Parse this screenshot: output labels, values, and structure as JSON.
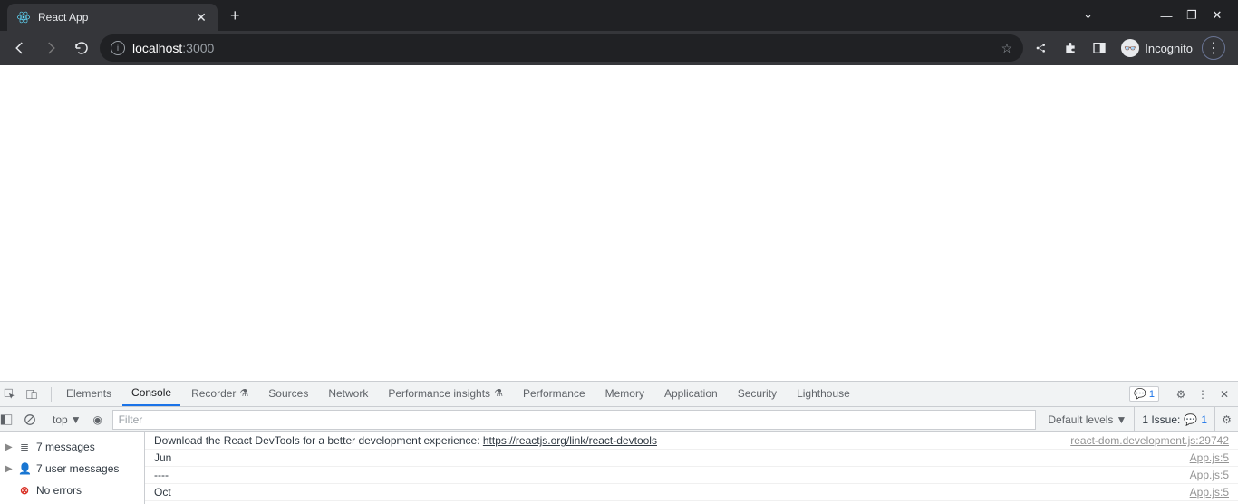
{
  "tab": {
    "title": "React App"
  },
  "address": {
    "host": "localhost",
    "port": ":3000"
  },
  "incognito_label": "Incognito",
  "devtools": {
    "tabs": [
      "Elements",
      "Console",
      "Recorder",
      "Sources",
      "Network",
      "Performance insights",
      "Performance",
      "Memory",
      "Application",
      "Security",
      "Lighthouse"
    ],
    "active_tab": "Console",
    "issues_badge": "1",
    "filter_placeholder": "Filter",
    "context": "top",
    "levels": "Default levels",
    "issues_label": "1 Issue:",
    "issues_count": "1",
    "sidebar": {
      "messages": "7 messages",
      "user_messages": "7 user messages",
      "no_errors": "No errors"
    },
    "log": [
      {
        "msg_prefix": "Download the React DevTools for a better development experience: ",
        "msg_link": "https://reactjs.org/link/react-devtools",
        "source": "react-dom.development.js:29742"
      },
      {
        "msg_prefix": "Jun",
        "msg_link": "",
        "source": "App.js:5"
      },
      {
        "msg_prefix": "----",
        "msg_link": "",
        "source": "App.js:5"
      },
      {
        "msg_prefix": "Oct",
        "msg_link": "",
        "source": "App.js:5"
      }
    ]
  }
}
